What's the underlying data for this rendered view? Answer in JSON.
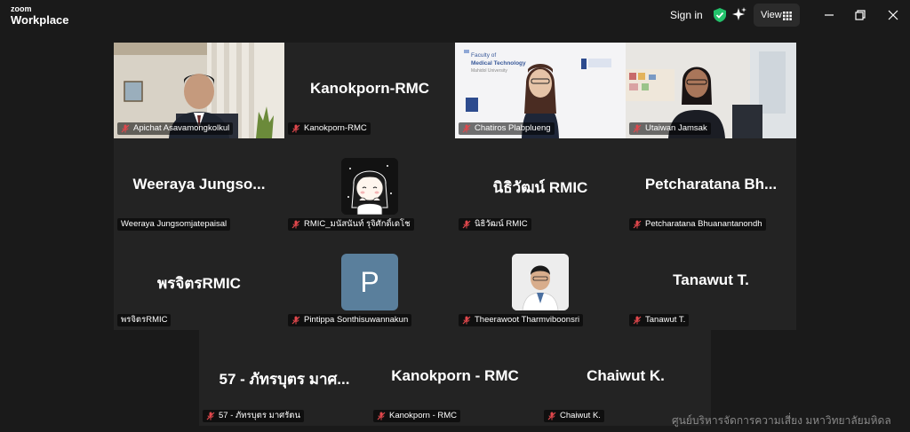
{
  "app": {
    "logo_line1": "zoom",
    "logo_line2": "Workplace",
    "signin": "Sign in",
    "view": "View"
  },
  "tiles": [
    {
      "name": "Apichat Asavamongkolkul",
      "big": ""
    },
    {
      "name": "Kanokporn-RMC",
      "big": "Kanokporn-RMC"
    },
    {
      "name": "Chatiros Plabplueng",
      "big": "",
      "slide_line1": "Faculty of",
      "slide_line2": "Medical Technology",
      "slide_line3": "Mahidol University"
    },
    {
      "name": "Utaiwan Jamsak",
      "big": ""
    },
    {
      "name": "Weeraya Jungsomjatepaisal",
      "big": "Weeraya  Jungso..."
    },
    {
      "name": "RMIC_มนัสนันท์ รุจิศักดิ์เดโช",
      "big": ""
    },
    {
      "name": "นิธิวัฒน์ RMIC",
      "big": "นิธิวัฒน์ RMIC"
    },
    {
      "name": "Petcharatana Bhuanantanondh",
      "big": "Petcharatana  Bh..."
    },
    {
      "name": "พรจิตรRMIC",
      "big": "พรจิตรRMIC"
    },
    {
      "name": "Pintippa Sonthisuwannakun",
      "big": "",
      "letter": "P"
    },
    {
      "name": "Theerawoot Tharmviboonsri",
      "big": ""
    },
    {
      "name": "Tanawut T.",
      "big": "Tanawut T."
    },
    {
      "name": "57 - ภัทรบุตร มาศรัตน",
      "big": "57 - ภัทรบุตร มาศ..."
    },
    {
      "name": "Kanokporn - RMC",
      "big": "Kanokporn - RMC"
    },
    {
      "name": "Chaiwut K.",
      "big": "Chaiwut K."
    }
  ],
  "watermark": "ศูนย์บริหารจัดการความเสี่ยง มหาวิทยาลัยมหิดล",
  "colors": {
    "background": "#1a1a1a",
    "tile": "#232323",
    "active_border": "#7fd17f",
    "mic_muted": "#e0474c",
    "avatar_p": "#5a7f9c"
  }
}
